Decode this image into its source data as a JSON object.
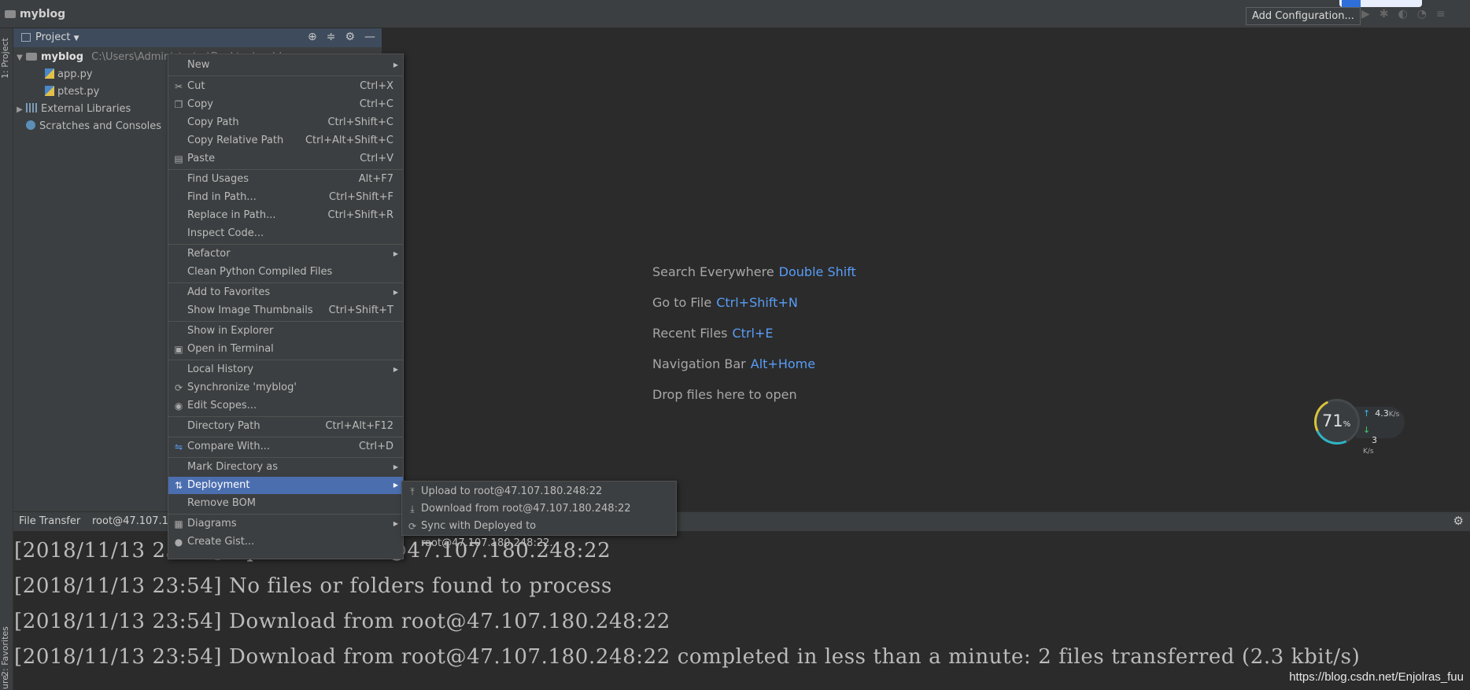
{
  "titlebar": {
    "project": "myblog",
    "add_configuration": "Add Configuration..."
  },
  "left_strip": {
    "project_tab": "1: Project",
    "favorites_tab": "2: Favorites",
    "structure_tab": "ure"
  },
  "project_panel": {
    "title": "Project",
    "tree": [
      {
        "name": "myblog",
        "path": "C:\\Users\\Administrator\\Desktop\\myblog"
      },
      {
        "name": "app.py"
      },
      {
        "name": "ptest.py"
      },
      {
        "name": "External Libraries"
      },
      {
        "name": "Scratches and Consoles"
      }
    ]
  },
  "context_menu": {
    "items": [
      {
        "label": "New",
        "shortcut": ""
      },
      {
        "label": "Cut",
        "shortcut": "Ctrl+X"
      },
      {
        "label": "Copy",
        "shortcut": "Ctrl+C"
      },
      {
        "label": "Copy Path",
        "shortcut": "Ctrl+Shift+C"
      },
      {
        "label": "Copy Relative Path",
        "shortcut": "Ctrl+Alt+Shift+C"
      },
      {
        "label": "Paste",
        "shortcut": "Ctrl+V"
      },
      {
        "label": "Find Usages",
        "shortcut": "Alt+F7"
      },
      {
        "label": "Find in Path...",
        "shortcut": "Ctrl+Shift+F"
      },
      {
        "label": "Replace in Path...",
        "shortcut": "Ctrl+Shift+R"
      },
      {
        "label": "Inspect Code...",
        "shortcut": ""
      },
      {
        "label": "Refactor",
        "shortcut": ""
      },
      {
        "label": "Clean Python Compiled Files",
        "shortcut": ""
      },
      {
        "label": "Add to Favorites",
        "shortcut": ""
      },
      {
        "label": "Show Image Thumbnails",
        "shortcut": "Ctrl+Shift+T"
      },
      {
        "label": "Show in Explorer",
        "shortcut": ""
      },
      {
        "label": "Open in Terminal",
        "shortcut": ""
      },
      {
        "label": "Local History",
        "shortcut": ""
      },
      {
        "label": "Synchronize 'myblog'",
        "shortcut": ""
      },
      {
        "label": "Edit Scopes...",
        "shortcut": ""
      },
      {
        "label": "Directory Path",
        "shortcut": "Ctrl+Alt+F12"
      },
      {
        "label": "Compare With...",
        "shortcut": "Ctrl+D"
      },
      {
        "label": "Mark Directory as",
        "shortcut": ""
      },
      {
        "label": "Deployment",
        "shortcut": ""
      },
      {
        "label": "Remove BOM",
        "shortcut": ""
      },
      {
        "label": "Diagrams",
        "shortcut": ""
      },
      {
        "label": "Create Gist...",
        "shortcut": ""
      }
    ]
  },
  "deployment_submenu": {
    "items": [
      {
        "label": "Upload to root@47.107.180.248:22"
      },
      {
        "label": "Download from root@47.107.180.248:22"
      },
      {
        "label": "Sync with Deployed to root@47.107.180.248:22..."
      }
    ]
  },
  "editor_hints": [
    {
      "label": "Search Everywhere",
      "key": "Double Shift"
    },
    {
      "label": "Go to File",
      "key": "Ctrl+Shift+N"
    },
    {
      "label": "Recent Files",
      "key": "Ctrl+E"
    },
    {
      "label": "Navigation Bar",
      "key": "Alt+Home"
    },
    {
      "label": "Drop files here to open",
      "key": ""
    }
  ],
  "bottom_panel": {
    "tab_file_transfer": "File Transfer",
    "tab_server": "root@47.107.1"
  },
  "console": {
    "lines": [
      "[2018/11/13 23:54] Upload to root@47.107.180.248:22",
      "[2018/11/13 23:54] No files or folders found to process",
      "[2018/11/13 23:54] Download from root@47.107.180.248:22",
      "[2018/11/13 23:54] Download from root@47.107.180.248:22 completed in less than a minute: 2 files transferred (2.3 kbit/s)"
    ]
  },
  "net_widget": {
    "percent": "71",
    "percent_unit": "%",
    "up": "4.3",
    "up_unit": "K/s",
    "down": "3",
    "down_unit": "K/s"
  },
  "watermark": "https://blog.csdn.net/Enjolras_fuu",
  "colors": {
    "menu_highlight": "#4b6eaf",
    "hint_key": "#589df6"
  }
}
